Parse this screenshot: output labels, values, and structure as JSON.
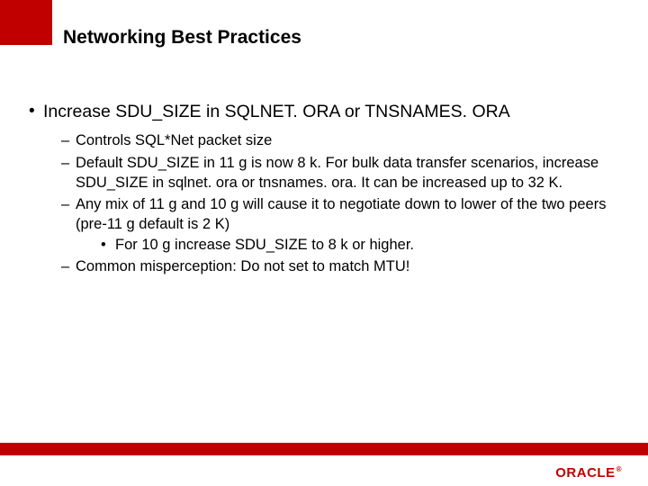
{
  "title": "Networking Best Practices",
  "main_bullet": "Increase SDU_SIZE in SQLNET. ORA or TNSNAMES. ORA",
  "sub": {
    "a": "Controls SQL*Net packet size",
    "b": "Default SDU_SIZE in 11 g is now 8 k. For bulk data transfer scenarios, increase SDU_SIZE in sqlnet. ora or tnsnames. ora. It can be increased up to 32 K.",
    "c": "Any mix of 11 g and 10 g will cause it to negotiate down  to lower of the two peers (pre-11 g default is 2 K)",
    "c_sub": "For 10 g increase SDU_SIZE to 8 k or higher.",
    "d": "Common misperception: Do not set to match MTU!"
  },
  "brand": "ORACLE",
  "brand_reg": "®",
  "colors": {
    "accent": "#c00000"
  }
}
